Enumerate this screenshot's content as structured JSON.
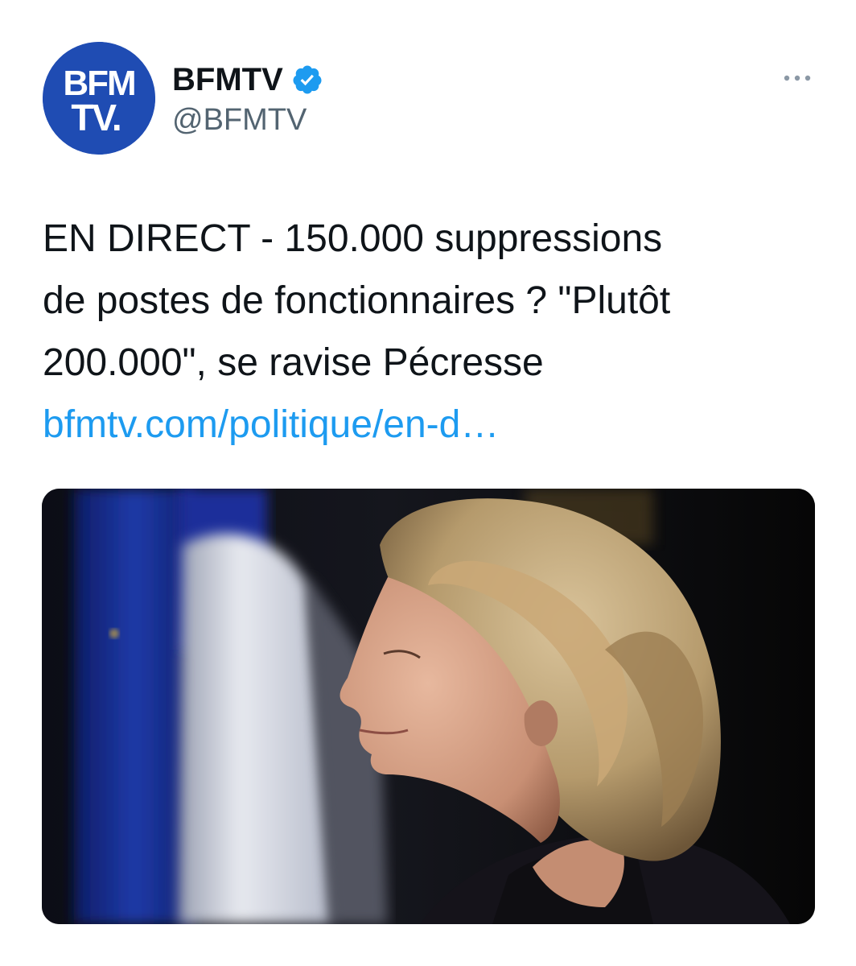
{
  "account": {
    "display_name": "BFMTV",
    "handle": "@BFMTV",
    "verified": true,
    "avatar_logo_text_top": "BFM",
    "avatar_logo_text_bottom": "TV.",
    "avatar_icon": "bfmtv-logo",
    "avatar_color": "#1f4cb3"
  },
  "tweet": {
    "text_lines": [
      "EN DIRECT - 150.000 suppressions",
      "de postes de fonctionnaires ? \"Plutôt",
      "200.000\", se ravise Pécresse"
    ],
    "link_text": "bfmtv.com/politique/en-d…",
    "link_color": "#1d9bf0"
  },
  "media": {
    "icon": "photo-woman-profile-in-front-of-flags"
  },
  "toolbar": {
    "more_icon": "more-dots-icon"
  }
}
